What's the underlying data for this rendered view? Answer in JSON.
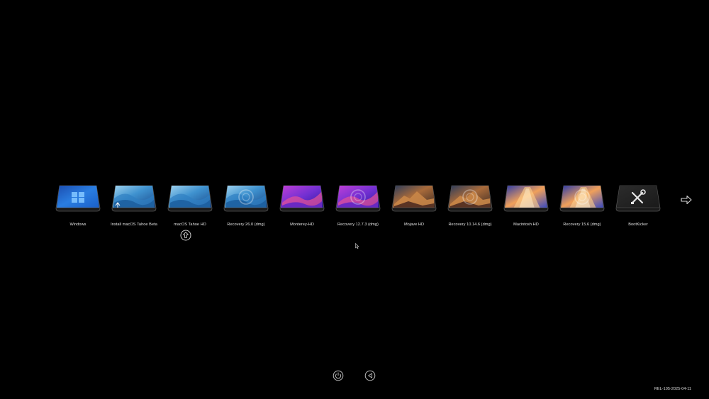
{
  "boot_entries": [
    {
      "label": "Windows",
      "icon": "windows-logo-icon",
      "theme": "windows",
      "overlay": "none"
    },
    {
      "label": "Install macOS Tahoe Beta",
      "icon": "macos-tahoe-wallpaper-icon",
      "theme": "tahoe",
      "overlay": "installer"
    },
    {
      "label": "macOS Tahoe HD",
      "icon": "macos-tahoe-wallpaper-icon",
      "theme": "tahoe",
      "overlay": "none"
    },
    {
      "label": "Recovery 26.0 (dmg)",
      "icon": "recovery-tahoe-icon",
      "theme": "tahoe",
      "overlay": "recovery"
    },
    {
      "label": "Monterey-HD",
      "icon": "macos-monterey-wallpaper-icon",
      "theme": "monterey",
      "overlay": "none"
    },
    {
      "label": "Recovery 12.7.3 (dmg)",
      "icon": "recovery-monterey-icon",
      "theme": "monterey",
      "overlay": "recovery"
    },
    {
      "label": "Mojave HD",
      "icon": "macos-mojave-wallpaper-icon",
      "theme": "mojave",
      "overlay": "none"
    },
    {
      "label": "Recovery 10.14.6 (dmg)",
      "icon": "recovery-mojave-icon",
      "theme": "mojave",
      "overlay": "recovery"
    },
    {
      "label": "Macintosh HD",
      "icon": "macos-sequoia-wallpaper-icon",
      "theme": "sequoia",
      "overlay": "none"
    },
    {
      "label": "Recovery 15.6 (dmg)",
      "icon": "recovery-sequoia-icon",
      "theme": "sequoia",
      "overlay": "recovery"
    },
    {
      "label": "BootKicker",
      "icon": "tools-wrench-screwdriver-icon",
      "theme": "tools",
      "overlay": "none"
    }
  ],
  "selected_index": 2,
  "selected_marker_icon": "upload-arrow-circle-icon",
  "next_page_icon": "next-page-arrow-icon",
  "bottom_buttons": [
    {
      "name": "shutdown-button",
      "icon": "power-icon"
    },
    {
      "name": "reboot-button",
      "icon": "restart-icon"
    }
  ],
  "version_text": "REL-105-2025-04-11",
  "colors": {
    "background": "#000000",
    "label_text": "#e6e6e6",
    "windows_blue": "#1f6fd6",
    "tahoe_blue": "#3b8fd0",
    "monterey_purple": "#7a2fd0",
    "mojave_orange": "#b9773d",
    "sequoia_orange": "#e8844a",
    "tools_gray": "#2a2a2a"
  }
}
